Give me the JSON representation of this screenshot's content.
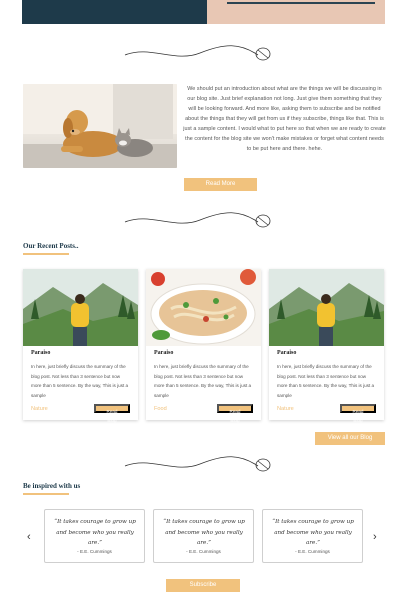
{
  "colors": {
    "accent": "#f1c27d",
    "dark": "#1e3a4a",
    "hero_right": "#e8c7b4"
  },
  "intro": {
    "text": "We should put an introduction about what are the things we will be discussing in our blog site. Just brief explanation not long. Just give them something that they will be looking forward. And more like, asking them to subscribe and be notified about the things that they will get from us if they subscribe, things like that. This is just a sample content. I would what to put here so that when we are ready to create the content for the blog site we won't make mistakes or forget what content needs to be put here and there. hehe.",
    "read_more": "Read More",
    "image_icon": "dog-and-cat-photo"
  },
  "recent": {
    "title": "Our Recent Posts..",
    "cards": [
      {
        "title": "Paraiso",
        "body": "In here, just briefly discuss the summary of the blog post. Not less than 3 sentence but now more than 5 sentence. By the way, This is just a sample",
        "category": "Nature",
        "button": "Read Blog",
        "image_icon": "hiker-mountain-photo"
      },
      {
        "title": "Paraiso",
        "body": "In here, just briefly discuss the summary of the blog post. Not less than 3 sentence but now more than 5 sentence. By the way, This is just a sample",
        "category": "Food",
        "button": "Read Blog",
        "image_icon": "noodle-soup-photo"
      },
      {
        "title": "Paraiso",
        "body": "In here, just briefly discuss the summary of the blog post. Not less than 3 sentence but now more than 5 sentence. By the way, This is just a sample",
        "category": "Nature",
        "button": "Read Blog",
        "image_icon": "hiker-mountain-photo"
      }
    ],
    "view_all": "View all our Blog"
  },
  "inspired": {
    "title": "Be inspired with us",
    "quotes": [
      {
        "text": "“It takes courage to grow up and become who you really are.”",
        "author": "- E.E. Cummings"
      },
      {
        "text": "“It takes courage to grow up and become who you really are.”",
        "author": "- E.E. Cummings"
      },
      {
        "text": "“It takes courage to grow up and become who you really are.”",
        "author": "- E.E. Cummings"
      }
    ],
    "prev_icon": "chevron-left-icon",
    "next_icon": "chevron-right-icon",
    "prev": "‹",
    "next": "›"
  },
  "subscribe": {
    "label": "Subscribe"
  }
}
